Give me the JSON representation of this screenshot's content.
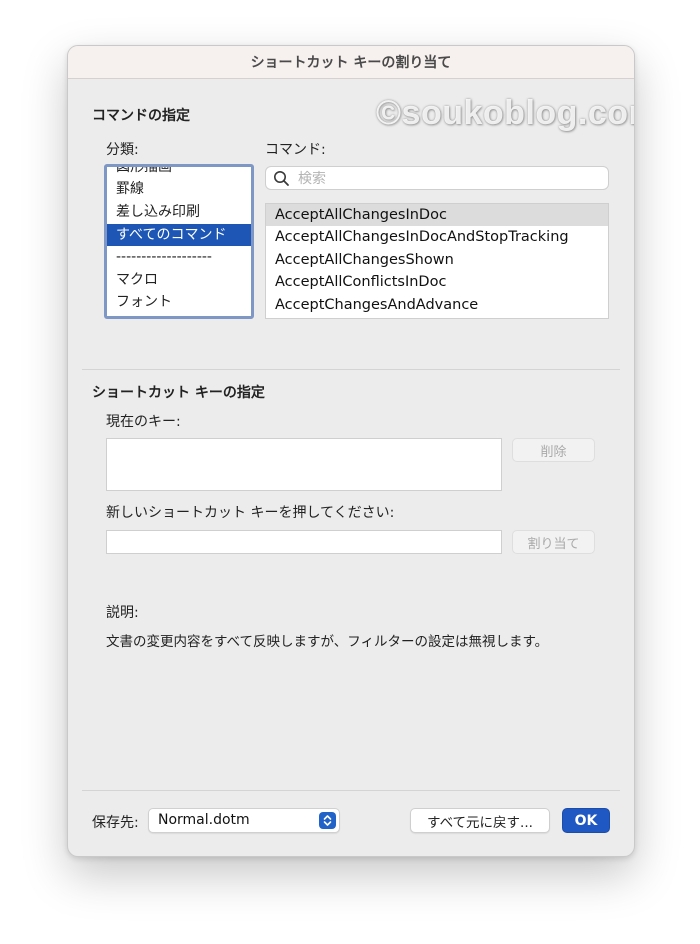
{
  "window": {
    "title": "ショートカット キーの割り当て"
  },
  "watermark": "©soukoblog.com",
  "command_section": {
    "title": "コマンドの指定",
    "categories_label": "分類:",
    "commands_label": "コマンド:",
    "categories": [
      {
        "label": "図形描画"
      },
      {
        "label": "罫線"
      },
      {
        "label": "差し込み印刷"
      },
      {
        "label": "すべてのコマンド",
        "selected": true
      },
      {
        "label": "-------------------"
      },
      {
        "label": "マクロ"
      },
      {
        "label": "フォント"
      }
    ],
    "search": {
      "placeholder": "検索",
      "value": ""
    },
    "commands": [
      {
        "label": "AcceptAllChangesInDoc",
        "selected": true
      },
      {
        "label": "AcceptAllChangesInDocAndStopTracking"
      },
      {
        "label": "AcceptAllChangesShown"
      },
      {
        "label": "AcceptAllConflictsInDoc"
      },
      {
        "label": "AcceptChangesAndAdvance"
      }
    ]
  },
  "shortcut_section": {
    "title": "ショートカット キーの指定",
    "current_keys_label": "現在のキー:",
    "remove_button": "削除",
    "new_key_label": "新しいショートカット キーを押してください:",
    "new_key_value": "",
    "assign_button": "割り当て"
  },
  "description": {
    "label": "説明:",
    "text": "文書の変更内容をすべて反映しますが、フィルターの設定は無視します。"
  },
  "footer": {
    "save_in_label": "保存先:",
    "save_in_value": "Normal.dotm",
    "reset_button": "すべて元に戻す...",
    "ok_button": "OK"
  },
  "colors": {
    "accent": "#1f57c3",
    "selection": "#1d56b5",
    "dialog_bg": "#ececec"
  },
  "icons": {
    "search": "search-icon",
    "popup": "up-down-chevron-icon"
  }
}
